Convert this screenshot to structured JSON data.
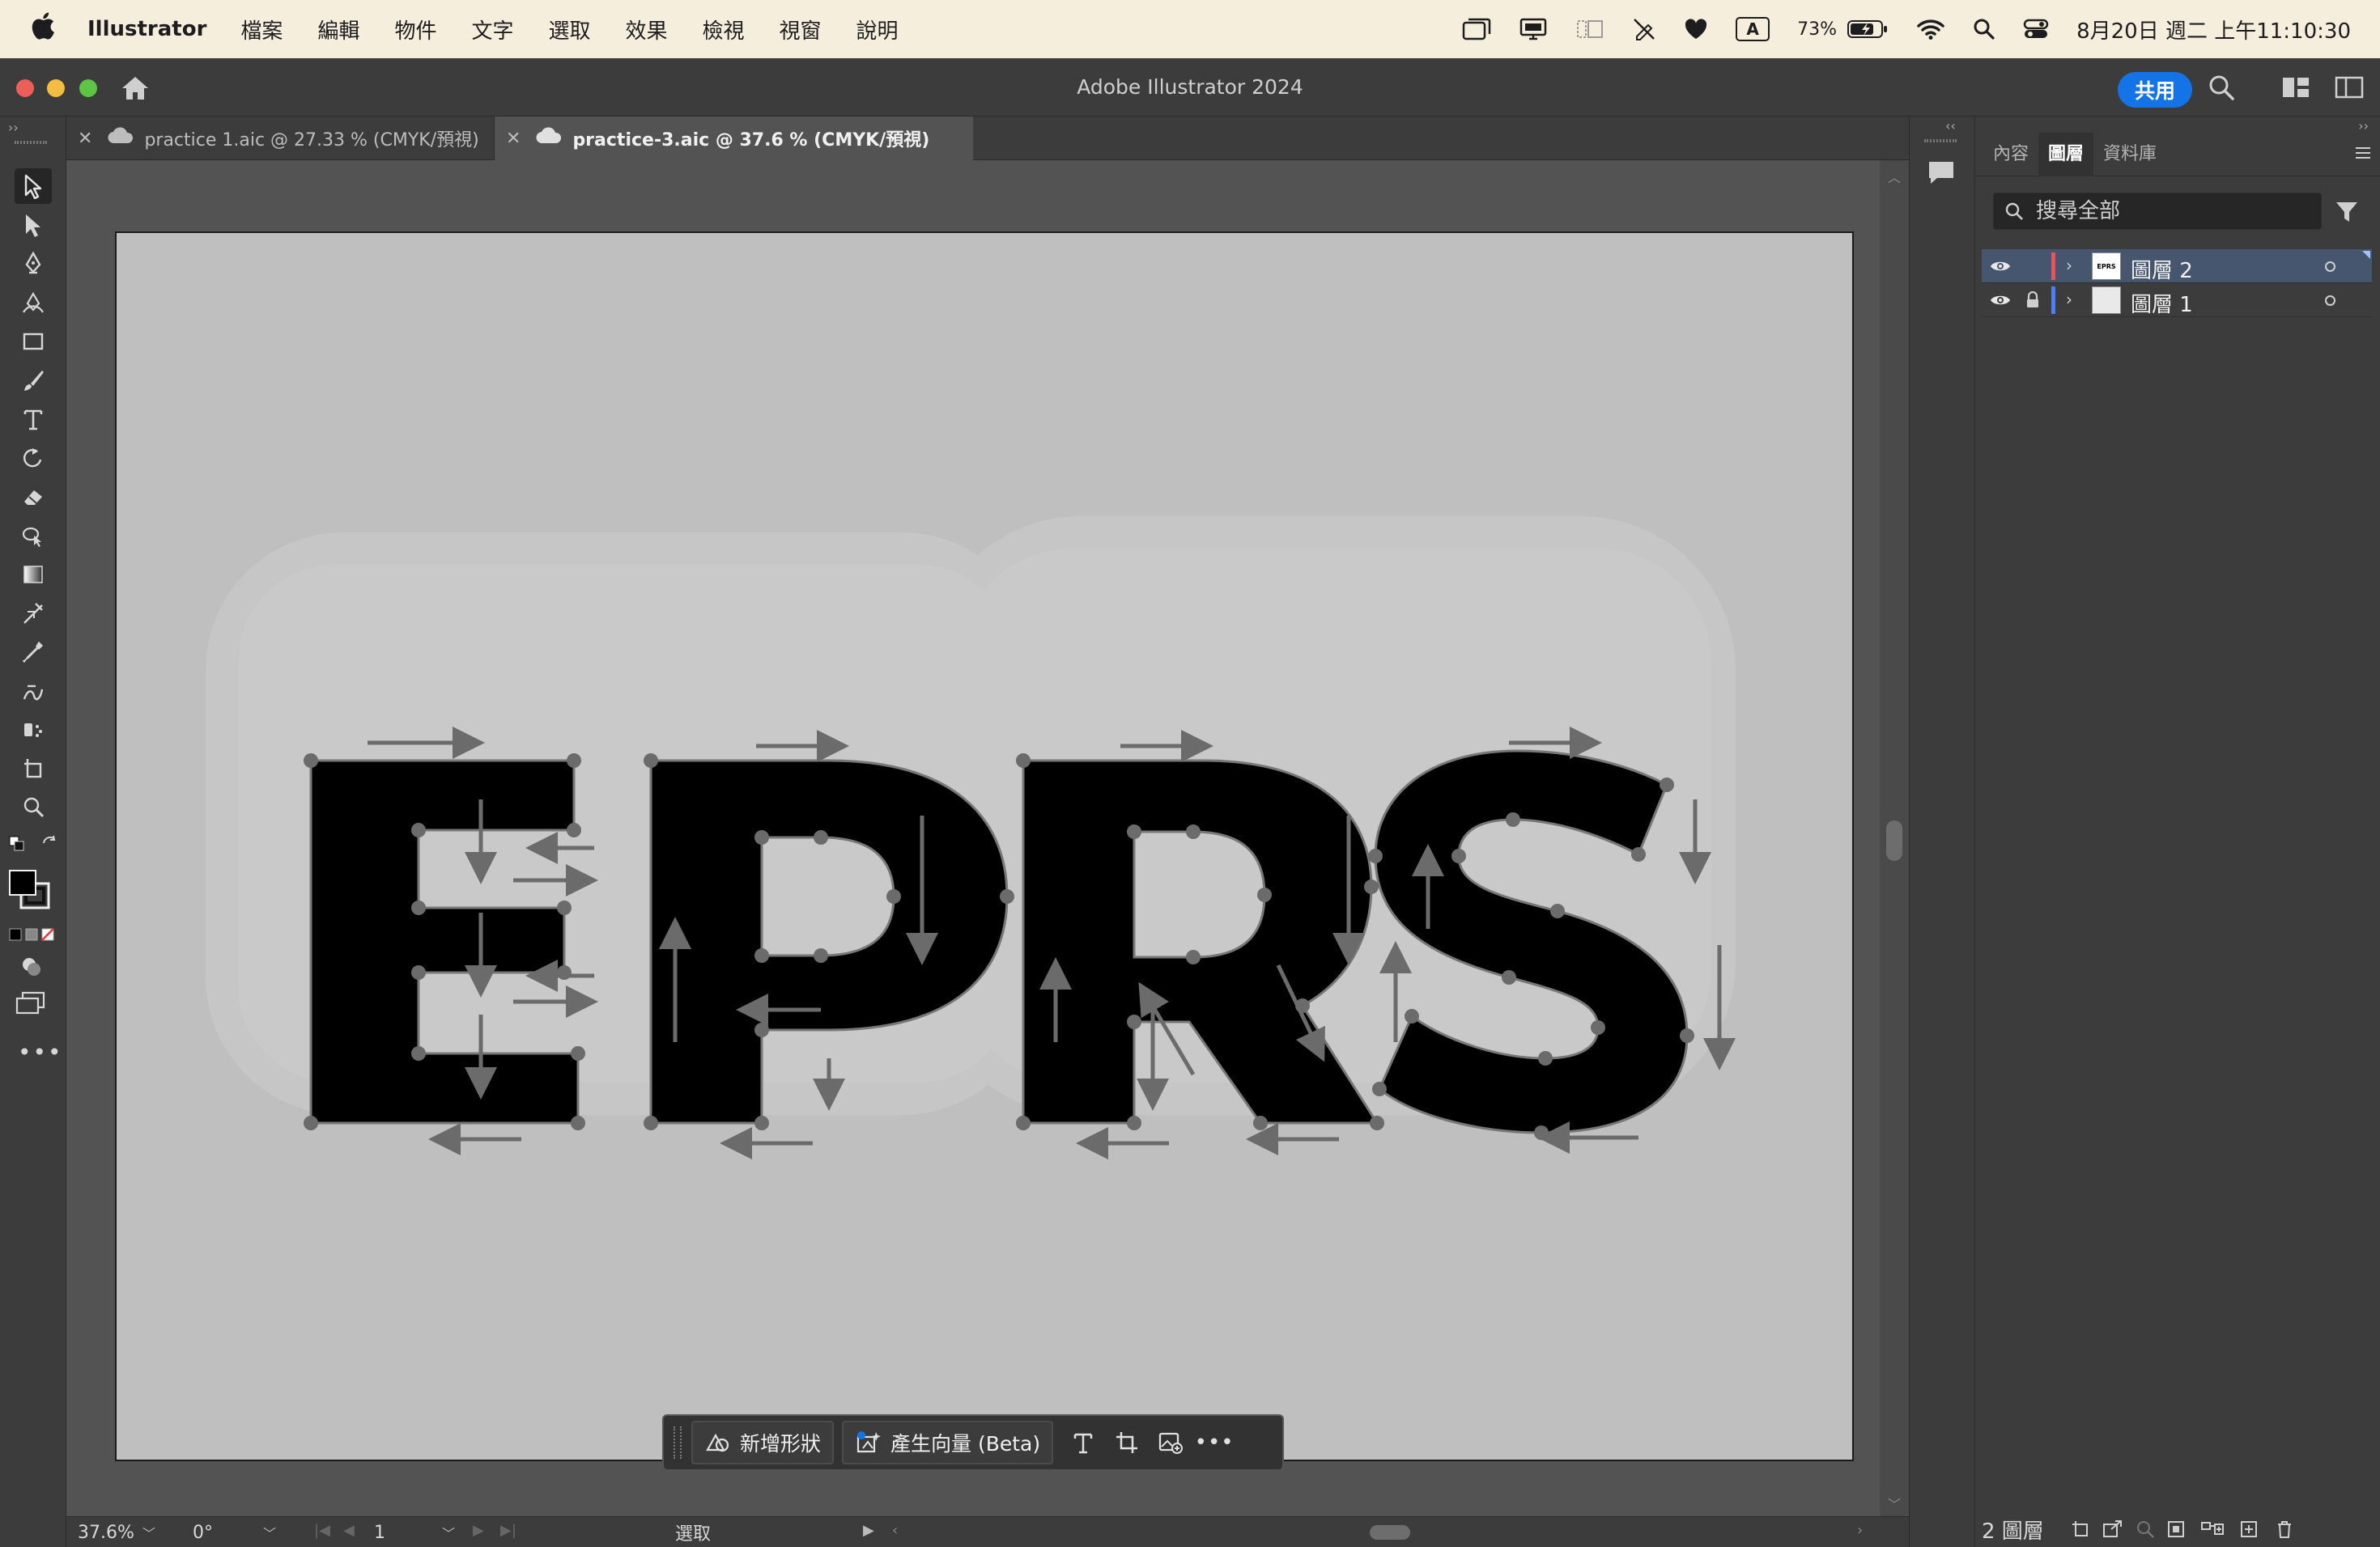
{
  "menubar": {
    "app_name": "Illustrator",
    "menus": [
      "檔案",
      "編輯",
      "物件",
      "文字",
      "選取",
      "效果",
      "檢視",
      "視窗",
      "說明"
    ],
    "battery": "73%",
    "datetime": "8月20日 週二 上午11:10:30",
    "input_method": "A"
  },
  "window": {
    "title": "Adobe Illustrator 2024",
    "share_label": "共用"
  },
  "tabs": [
    {
      "label": "practice 1.aic @ 27.33 % (CMYK/預視)",
      "active": false
    },
    {
      "label": "practice-3.aic @ 37.6 % (CMYK/預視)",
      "active": true
    }
  ],
  "artwork": {
    "text": "EPRS",
    "letters": [
      "E",
      "P",
      "R",
      "S"
    ],
    "fill_color": "#000000",
    "artboard_color": "#bfbfbf",
    "halo_color": "#c9c9c9",
    "anchor_color": "#6b6b6b"
  },
  "taskbar": {
    "new_shape_label": "新增形狀",
    "generate_vector_label": "產生向量 (Beta)"
  },
  "statusbar": {
    "zoom": "37.6%",
    "rotation": "0°",
    "artboard_number": "1",
    "tool_status": "選取"
  },
  "layers_panel": {
    "tabs": [
      "內容",
      "圖層",
      "資料庫"
    ],
    "active_tab": "圖層",
    "search_placeholder": "搜尋全部",
    "layers": [
      {
        "name": "圖層 2",
        "color": "#e8545a",
        "thumbnail_text": "EPRS",
        "selected": true,
        "locked": false
      },
      {
        "name": "圖層 1",
        "color": "#4f7df5",
        "thumbnail_text": "",
        "selected": false,
        "locked": true
      }
    ],
    "layer_count": "2 圖層"
  },
  "accent_color": "#1473e6"
}
